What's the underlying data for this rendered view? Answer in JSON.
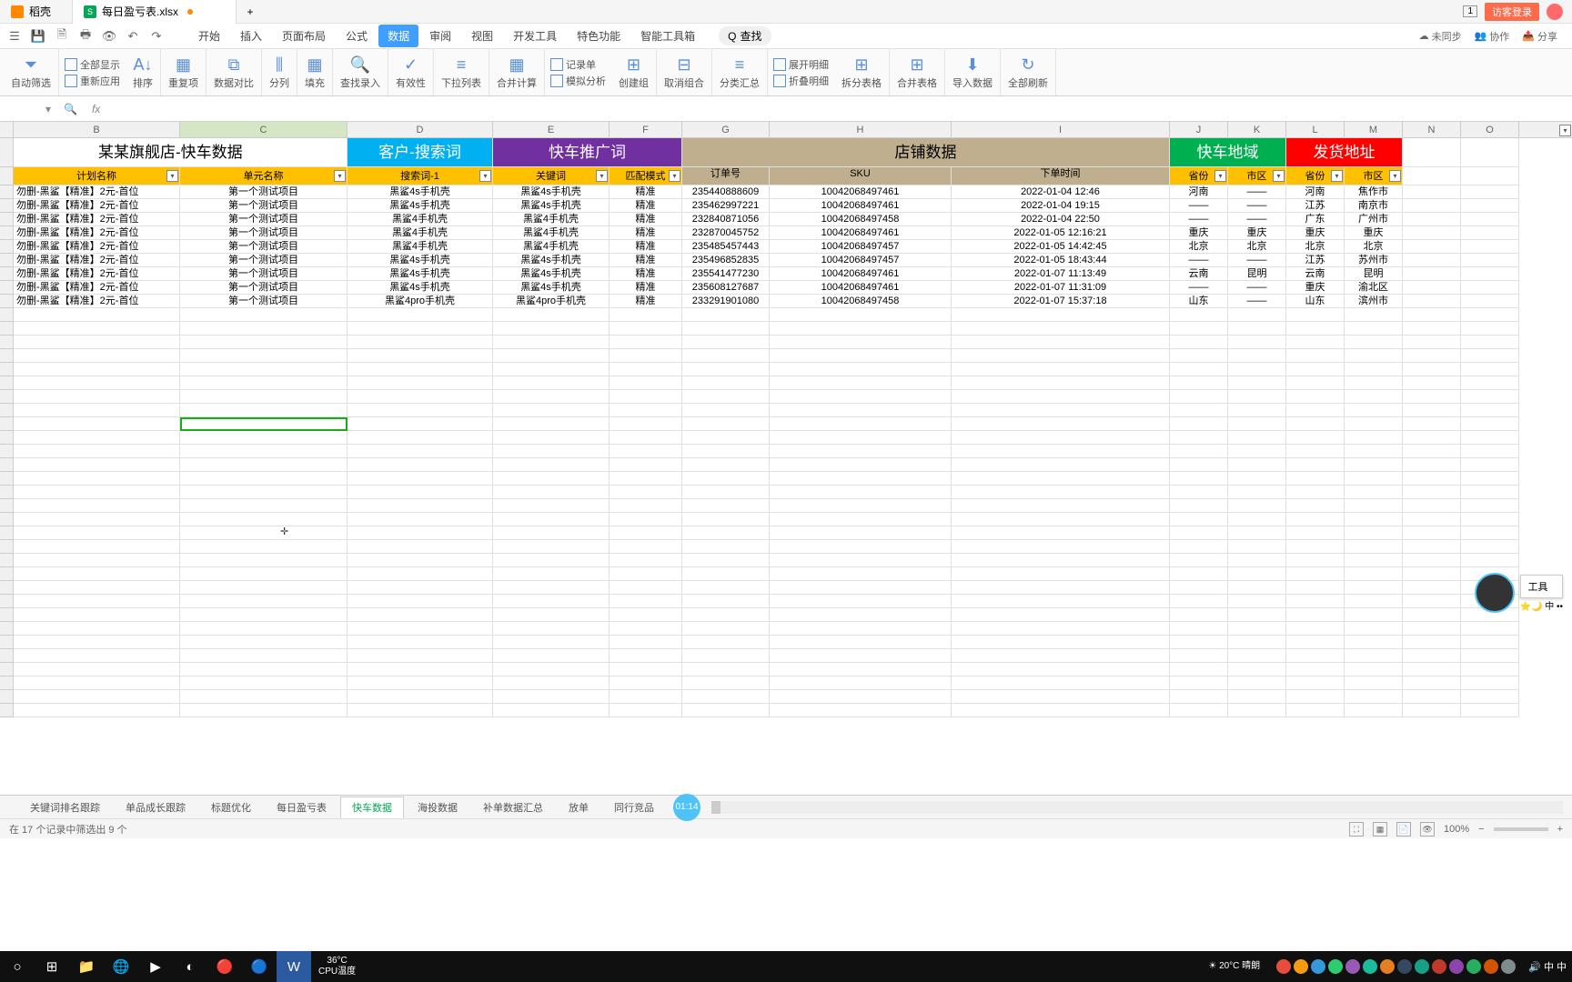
{
  "title_bar": {
    "home_tab": "稻壳",
    "file_tab": "每日盈亏表.xlsx",
    "badge": "1",
    "guest": "访客登录"
  },
  "menu": {
    "items": [
      "开始",
      "插入",
      "页面布局",
      "公式",
      "数据",
      "审阅",
      "视图",
      "开发工具",
      "特色功能",
      "智能工具箱"
    ],
    "active_index": 4,
    "search": "查找"
  },
  "top_right": {
    "unsync": "未同步",
    "collab": "协作",
    "share": "分享"
  },
  "ribbon": {
    "auto_filter": "自动筛选",
    "show_all": "全部显示",
    "reapply": "重新应用",
    "sort": "排序",
    "dup": "重复项",
    "compare": "数据对比",
    "split": "分列",
    "fill": "填充",
    "find_entry": "查找录入",
    "validity": "有效性",
    "dropdown": "下拉列表",
    "consolidate": "合并计算",
    "record": "记录单",
    "sim": "模拟分析",
    "create_group": "创建组",
    "ungroup": "取消组合",
    "subtotal": "分类汇总",
    "expand": "展开明细",
    "collapse": "折叠明细",
    "split_table": "拆分表格",
    "merge_table": "合并表格",
    "import": "导入数据",
    "refresh": "全部刷新"
  },
  "columns": [
    "B",
    "C",
    "D",
    "E",
    "F",
    "G",
    "H",
    "I",
    "J",
    "K",
    "L",
    "M",
    "N",
    "O"
  ],
  "banner": {
    "store": "某某旗舰店-快车数据",
    "search": "客户-搜索词",
    "promo": "快车推广词",
    "shop": "店铺数据",
    "region": "快车地域",
    "ship": "发货地址"
  },
  "headers": {
    "plan": "计划名称",
    "unit": "单元名称",
    "search1": "搜索词-1",
    "keyword": "关键词",
    "match": "匹配模式",
    "order": "订单号",
    "sku": "SKU",
    "time": "下单时间",
    "prov1": "省份",
    "city1": "市区",
    "prov2": "省份",
    "city2": "市区"
  },
  "rows": [
    {
      "plan": "勿删-黑鲨【精准】2元-首位",
      "unit": "第一个测试项目",
      "sw": "黑鲨4s手机壳",
      "kw": "黑鲨4s手机壳",
      "match": "精准",
      "order": "235440888609",
      "sku": "10042068497461",
      "time": "2022-01-04 12:46",
      "p1": "河南",
      "c1": "——",
      "p2": "河南",
      "c2": "焦作市"
    },
    {
      "plan": "勿删-黑鲨【精准】2元-首位",
      "unit": "第一个测试项目",
      "sw": "黑鲨4s手机壳",
      "kw": "黑鲨4s手机壳",
      "match": "精准",
      "order": "235462997221",
      "sku": "10042068497461",
      "time": "2022-01-04 19:15",
      "p1": "——",
      "c1": "——",
      "p2": "江苏",
      "c2": "南京市"
    },
    {
      "plan": "勿删-黑鲨【精准】2元-首位",
      "unit": "第一个测试项目",
      "sw": "黑鲨4手机壳",
      "kw": "黑鲨4手机壳",
      "match": "精准",
      "order": "232840871056",
      "sku": "10042068497458",
      "time": "2022-01-04 22:50",
      "p1": "——",
      "c1": "——",
      "p2": "广东",
      "c2": "广州市"
    },
    {
      "plan": "勿删-黑鲨【精准】2元-首位",
      "unit": "第一个测试项目",
      "sw": "黑鲨4手机壳",
      "kw": "黑鲨4手机壳",
      "match": "精准",
      "order": "232870045752",
      "sku": "10042068497461",
      "time": "2022-01-05 12:16:21",
      "p1": "重庆",
      "c1": "重庆",
      "p2": "重庆",
      "c2": "重庆"
    },
    {
      "plan": "勿删-黑鲨【精准】2元-首位",
      "unit": "第一个测试项目",
      "sw": "黑鲨4手机壳",
      "kw": "黑鲨4手机壳",
      "match": "精准",
      "order": "235485457443",
      "sku": "10042068497457",
      "time": "2022-01-05 14:42:45",
      "p1": "北京",
      "c1": "北京",
      "p2": "北京",
      "c2": "北京"
    },
    {
      "plan": "勿删-黑鲨【精准】2元-首位",
      "unit": "第一个测试项目",
      "sw": "黑鲨4s手机壳",
      "kw": "黑鲨4s手机壳",
      "match": "精准",
      "order": "235496852835",
      "sku": "10042068497457",
      "time": "2022-01-05 18:43:44",
      "p1": "——",
      "c1": "——",
      "p2": "江苏",
      "c2": "苏州市"
    },
    {
      "plan": "勿删-黑鲨【精准】2元-首位",
      "unit": "第一个测试项目",
      "sw": "黑鲨4s手机壳",
      "kw": "黑鲨4s手机壳",
      "match": "精准",
      "order": "235541477230",
      "sku": "10042068497461",
      "time": "2022-01-07 11:13:49",
      "p1": "云南",
      "c1": "昆明",
      "p2": "云南",
      "c2": "昆明"
    },
    {
      "plan": "勿删-黑鲨【精准】2元-首位",
      "unit": "第一个测试项目",
      "sw": "黑鲨4s手机壳",
      "kw": "黑鲨4s手机壳",
      "match": "精准",
      "order": "235608127687",
      "sku": "10042068497461",
      "time": "2022-01-07 11:31:09",
      "p1": "——",
      "c1": "——",
      "p2": "重庆",
      "c2": "渝北区"
    },
    {
      "plan": "勿删-黑鲨【精准】2元-首位",
      "unit": "第一个测试项目",
      "sw": "黑鲨4pro手机壳",
      "kw": "黑鲨4pro手机壳",
      "match": "精准",
      "order": "233291901080",
      "sku": "10042068497458",
      "time": "2022-01-07 15:37:18",
      "p1": "山东",
      "c1": "——",
      "p2": "山东",
      "c2": "滨州市"
    }
  ],
  "sheet_tabs": [
    "关键词排名跟踪",
    "单品成长跟踪",
    "标题优化",
    "每日盈亏表",
    "快车数据",
    "海投数据",
    "补单数据汇总",
    "放单",
    "同行竞品"
  ],
  "sheet_active": 4,
  "timer": "01:14",
  "status": {
    "filter_info": "在 17 个记录中筛选出 9 个",
    "zoom": "100%"
  },
  "taskbar": {
    "temp": "36°C",
    "cpu": "CPU温度",
    "weather": "20°C 晴朗"
  },
  "float": {
    "tools": "工具"
  }
}
